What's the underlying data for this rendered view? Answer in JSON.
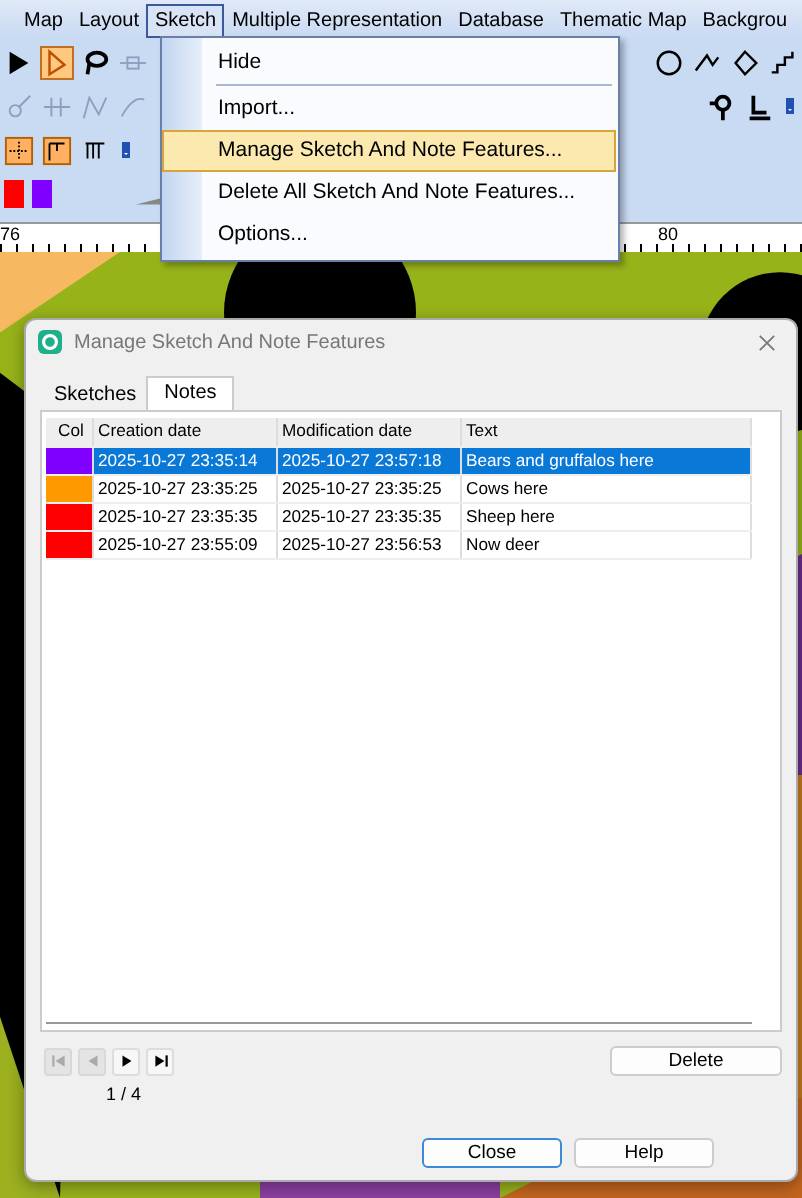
{
  "menu_bar": [
    {
      "label": "Map",
      "selected": false
    },
    {
      "label": "Layout",
      "selected": false
    },
    {
      "label": "Sketch",
      "selected": true
    },
    {
      "label": "Multiple Representation",
      "selected": false
    },
    {
      "label": "Database",
      "selected": false
    },
    {
      "label": "Thematic Map",
      "selected": false
    },
    {
      "label": "Backgrou",
      "selected": false
    }
  ],
  "sketch_menu": {
    "items": [
      {
        "label": "Hide",
        "selected": false,
        "separator_after": true
      },
      {
        "label": "Import...",
        "selected": false,
        "separator_after": false
      },
      {
        "label": "Manage Sketch And Note Features...",
        "selected": true,
        "separator_after": false
      },
      {
        "label": "Delete All Sketch And Note Features...",
        "selected": false,
        "separator_after": false
      },
      {
        "label": "Options...",
        "selected": false,
        "separator_after": false
      }
    ]
  },
  "swatches": [
    {
      "color": "#ff0000"
    },
    {
      "color": "#8000ff"
    }
  ],
  "ruler": {
    "labels": [
      "76",
      "80"
    ]
  },
  "dialog": {
    "title": "Manage Sketch And Note Features",
    "tabs": [
      {
        "label": "Sketches",
        "selected": false
      },
      {
        "label": "Notes",
        "selected": true
      }
    ],
    "table": {
      "columns": [
        "Col",
        "Creation date",
        "Modification date",
        "Text"
      ],
      "rows": [
        {
          "color": "#8000ff",
          "created": "2025-10-27 23:35:14",
          "modified": "2025-10-27 23:57:18",
          "text": "Bears and gruffalos here",
          "selected": true
        },
        {
          "color": "#ff9900",
          "created": "2025-10-27 23:35:25",
          "modified": "2025-10-27 23:35:25",
          "text": "Cows here",
          "selected": false
        },
        {
          "color": "#ff0000",
          "created": "2025-10-27 23:35:35",
          "modified": "2025-10-27 23:35:35",
          "text": "Sheep here",
          "selected": false
        },
        {
          "color": "#ff0000",
          "created": "2025-10-27 23:55:09",
          "modified": "2025-10-27 23:56:53",
          "text": "Now deer",
          "selected": false
        }
      ]
    },
    "nav": {
      "buttons": [
        {
          "kind": "first",
          "disabled": true
        },
        {
          "kind": "previous",
          "disabled": true
        },
        {
          "kind": "next",
          "disabled": false
        },
        {
          "kind": "last",
          "disabled": false
        }
      ],
      "position": "1 / 4"
    },
    "delete_button": "Delete",
    "buttons": [
      {
        "label": "Close",
        "focused": true
      },
      {
        "label": "Help",
        "focused": false
      }
    ]
  }
}
